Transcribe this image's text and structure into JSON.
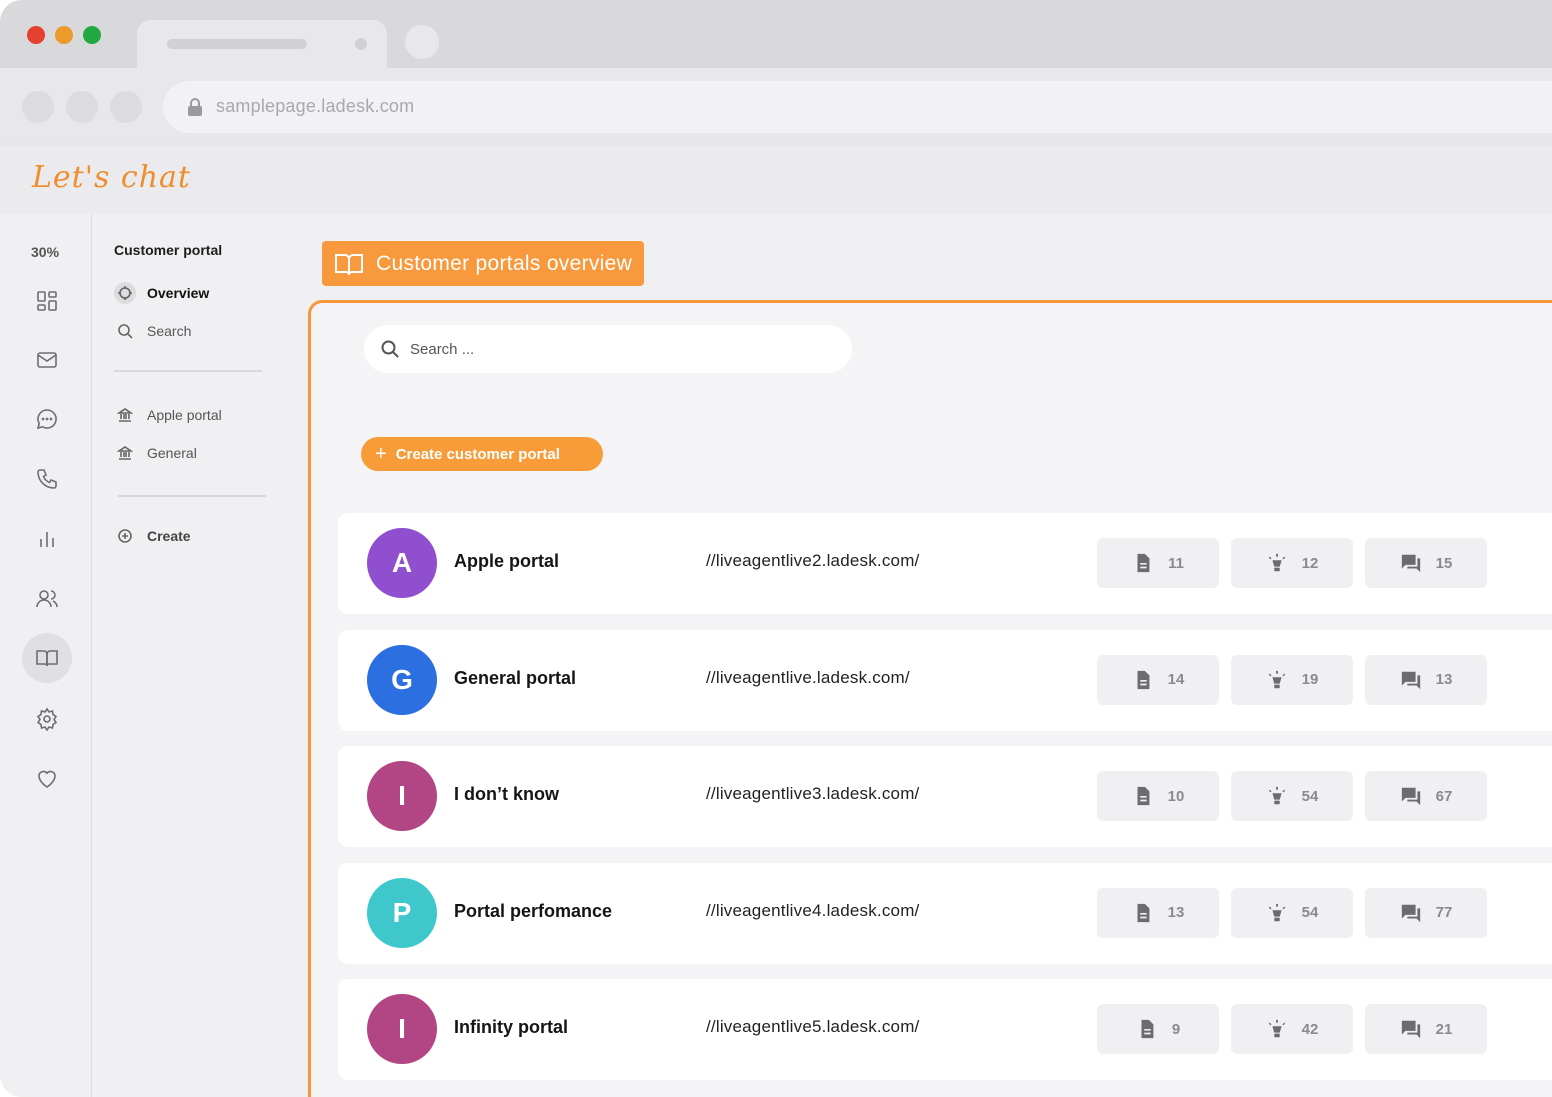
{
  "browser": {
    "url": "samplepage.ladesk.com"
  },
  "app": {
    "logo": "Let's chat",
    "usage_percent": "30%"
  },
  "rail": {
    "items": [
      {
        "icon": "dashboard-icon"
      },
      {
        "icon": "mail-icon"
      },
      {
        "icon": "chat-icon"
      },
      {
        "icon": "phone-icon"
      },
      {
        "icon": "reports-icon"
      },
      {
        "icon": "contacts-icon"
      },
      {
        "icon": "knowledgebase-icon",
        "active": true
      },
      {
        "icon": "settings-icon"
      },
      {
        "icon": "heart-icon"
      }
    ]
  },
  "sidebar": {
    "title": "Customer portal",
    "nav": [
      {
        "label": "Overview",
        "icon": "crosshair-icon",
        "active": true
      },
      {
        "label": "Search",
        "icon": "search-icon"
      }
    ],
    "portals": [
      {
        "label": "Apple portal",
        "icon": "bank-icon"
      },
      {
        "label": "General",
        "icon": "bank-icon"
      }
    ],
    "create_label": "Create"
  },
  "main": {
    "heading": "Customer portals overview",
    "search_placeholder": "Search ...",
    "create_button": "Create customer portal",
    "portals": [
      {
        "initial": "A",
        "color": "#8f4fcf",
        "name": "Apple portal",
        "url": "//liveagentlive2.ladesk.com/",
        "articles": "11",
        "ideas": "12",
        "topics": "15"
      },
      {
        "initial": "G",
        "color": "#2b6fe0",
        "name": "General portal",
        "url": "//liveagentlive.ladesk.com/",
        "articles": "14",
        "ideas": "19",
        "topics": "13"
      },
      {
        "initial": "I",
        "color": "#b24684",
        "name": "I don’t know",
        "url": "//liveagentlive3.ladesk.com/",
        "articles": "10",
        "ideas": "54",
        "topics": "67"
      },
      {
        "initial": "P",
        "color": "#3ec8cc",
        "name": "Portal perfomance",
        "url": "//liveagentlive4.ladesk.com/",
        "articles": "13",
        "ideas": "54",
        "topics": "77"
      },
      {
        "initial": "I",
        "color": "#b24684",
        "name": "Infinity portal",
        "url": "//liveagentlive5.ladesk.com/",
        "articles": "9",
        "ideas": "42",
        "topics": "21"
      }
    ]
  }
}
